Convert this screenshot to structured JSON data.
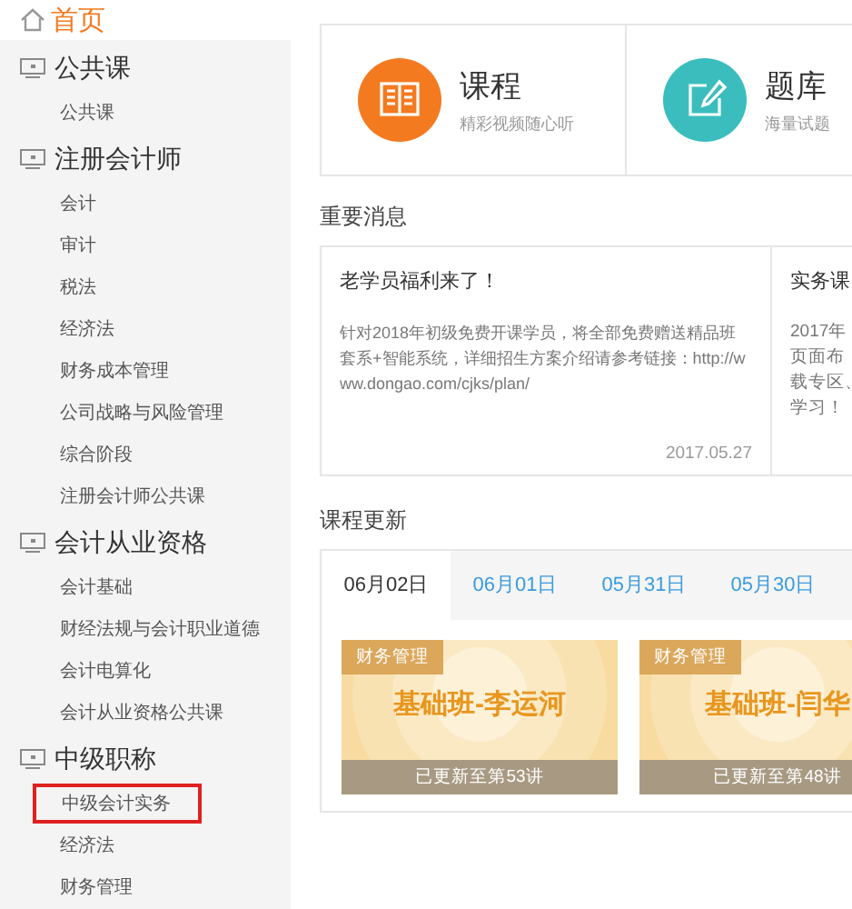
{
  "home": {
    "label": "首页"
  },
  "sidebar": {
    "groups": [
      {
        "title": "公共课",
        "items": [
          {
            "label": "公共课",
            "selected": false
          }
        ]
      },
      {
        "title": "注册会计师",
        "items": [
          {
            "label": "会计",
            "selected": false
          },
          {
            "label": "审计",
            "selected": false
          },
          {
            "label": "税法",
            "selected": false
          },
          {
            "label": "经济法",
            "selected": false
          },
          {
            "label": "财务成本管理",
            "selected": false
          },
          {
            "label": "公司战略与风险管理",
            "selected": false
          },
          {
            "label": "综合阶段",
            "selected": false
          },
          {
            "label": "注册会计师公共课",
            "selected": false
          }
        ]
      },
      {
        "title": "会计从业资格",
        "items": [
          {
            "label": "会计基础",
            "selected": false
          },
          {
            "label": "财经法规与会计职业道德",
            "selected": false
          },
          {
            "label": "会计电算化",
            "selected": false
          },
          {
            "label": "会计从业资格公共课",
            "selected": false
          }
        ]
      },
      {
        "title": "中级职称",
        "items": [
          {
            "label": "中级会计实务",
            "selected": true
          },
          {
            "label": "经济法",
            "selected": false
          },
          {
            "label": "财务管理",
            "selected": false
          }
        ]
      }
    ]
  },
  "features": [
    {
      "kind": "book",
      "title": "课程",
      "subtitle": "精彩视频随心听",
      "color": "#f47a20"
    },
    {
      "kind": "edit",
      "title": "题库",
      "subtitle": "海量试题",
      "color": "#3bbdbd"
    }
  ],
  "messages": {
    "heading": "重要消息",
    "items": [
      {
        "title": "老学员福利来了！",
        "body": "针对2018年初级免费开课学员，将全部免费赠送精品班套系+智能系统，详细招生方案介绍请参考链接：http://www.dongao.com/cjks/plan/",
        "date": "2017.05.27"
      },
      {
        "title": "实务课",
        "body_lines": [
          "2017年",
          "页面布",
          "载专区、",
          "学习！"
        ]
      }
    ]
  },
  "updates": {
    "heading": "课程更新",
    "tabs": [
      {
        "label": "06月02日",
        "selected": true
      },
      {
        "label": "06月01日",
        "selected": false
      },
      {
        "label": "05月31日",
        "selected": false
      },
      {
        "label": "05月30日",
        "selected": false
      }
    ],
    "courses": [
      {
        "tag": "财务管理",
        "title": "基础班-李运河",
        "progress": "已更新至第53讲"
      },
      {
        "tag": "财务管理",
        "title": "基础班-闫华",
        "progress": "已更新至第48讲"
      }
    ]
  }
}
